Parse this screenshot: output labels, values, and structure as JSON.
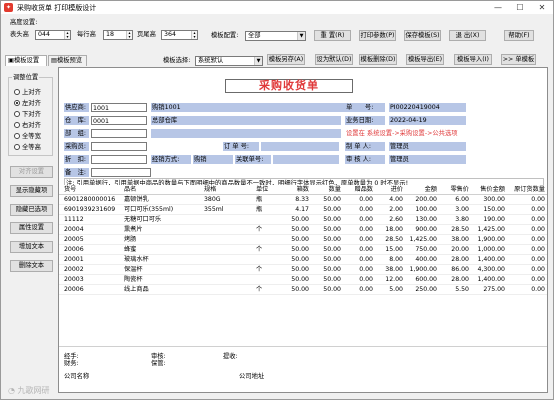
{
  "window": {
    "title": "采购收货单 打印模版设计"
  },
  "margins": {
    "group_label": "高度设置:",
    "header_label": "表头高",
    "header_value": "044",
    "row_label": "每行高",
    "row_value": "18",
    "footer_label": "页尾高",
    "footer_value": "364"
  },
  "template_setting": {
    "label": "模板配置:",
    "value": "全部"
  },
  "toolbar": {
    "reset": "重 置(R)",
    "print_params": "打印参数(P)",
    "save_template": "保存模板(S)",
    "exit": "退 出(X)",
    "help": "帮助(F)"
  },
  "tabs": {
    "template_settings": "模板设置",
    "template_preview": "模板预览"
  },
  "row2": {
    "template_select_label": "模板选择:",
    "template_select_value": "系统默认",
    "save_as": "模板另存(A)",
    "set_default": "设为默认(D)",
    "delete": "模板删除(D)",
    "export": "模板导出(E)",
    "import": "模板导入(I)",
    "single": ">> 单模板"
  },
  "align": {
    "title": "调整位置",
    "options": [
      "上对齐",
      "左对齐",
      "下对齐",
      "右对齐",
      "全等宽",
      "全等高"
    ],
    "selected": "左对齐"
  },
  "side_buttons": {
    "align_setting": "对齐设置",
    "show_hidden": "显示隐藏项",
    "hide_selected": "隐藏已选项",
    "properties": "属性设置",
    "add_text": "增加文本",
    "delete_text": "删除文本"
  },
  "bill": {
    "title": "采购收货单",
    "supplier_label": "供应商:",
    "supplier_code": "1001",
    "supplier_name": "购销1001",
    "warehouse_label": "仓　库:",
    "warehouse_code": "0001",
    "warehouse_name": "总部仓库",
    "dept_label": "部　组:",
    "buyer_label": "采购员:",
    "discount_label": "折　扣:",
    "remark_label": "备　注:",
    "docno_label": "单　　号:",
    "docno_value": "PI00220419004",
    "bizdate_label": "业务日期:",
    "bizdate_value": "2022-04-19",
    "settings_hint": "设置在 系统设置->采购设置->公共选项",
    "order_label": "订 单 号:",
    "maker_label": "制 单 人:",
    "maker_value": "管理员",
    "settle_label": "经销方式:",
    "settle_value": "购销",
    "related_label": "关联单号:",
    "auditor_label": "审 核 人:",
    "auditor_value": "管理员",
    "note_label": "注:",
    "note_text": "引用单据行，引用单据中商品的数量与下面明细中的商品数量不一致时，明细行字体显示红色，原单数量为 0 时不显示!"
  },
  "table": {
    "headers": [
      "货号",
      "品名",
      "规格",
      "单位",
      "箱数",
      "数量",
      "赠品数",
      "进价",
      "金额",
      "零售价",
      "售价金额",
      "原订货数量"
    ],
    "rows": [
      [
        "6901280000016",
        "嘉顿饼乳",
        "380G",
        "瓶",
        "8.33",
        "50.00",
        "0.00",
        "4.00",
        "200.00",
        "6.00",
        "300.00",
        "0.00"
      ],
      [
        "6901939231609",
        "可口可乐(355ml)",
        "355ml",
        "瓶",
        "4.17",
        "50.00",
        "0.00",
        "2.00",
        "100.00",
        "3.00",
        "150.00",
        "0.00"
      ],
      [
        "11112",
        "无糖可口可乐",
        "",
        "",
        "50.00",
        "50.00",
        "0.00",
        "2.60",
        "130.00",
        "3.80",
        "190.00",
        "0.00"
      ],
      [
        "20004",
        "熏煮片",
        "",
        "个",
        "50.00",
        "50.00",
        "0.00",
        "18.00",
        "900.00",
        "28.50",
        "1,425.00",
        "0.00"
      ],
      [
        "20005",
        "烤肠",
        "",
        "",
        "50.00",
        "50.00",
        "0.00",
        "28.50",
        "1,425.00",
        "38.00",
        "1,900.00",
        "0.00"
      ],
      [
        "20006",
        "蜂蜜",
        "",
        "个",
        "50.00",
        "50.00",
        "0.00",
        "15.00",
        "750.00",
        "20.00",
        "1,000.00",
        "0.00"
      ],
      [
        "20001",
        "玻璃水杯",
        "",
        "",
        "50.00",
        "50.00",
        "0.00",
        "8.00",
        "400.00",
        "28.00",
        "1,400.00",
        "0.00"
      ],
      [
        "20002",
        "保温杯",
        "",
        "个",
        "50.00",
        "50.00",
        "0.00",
        "38.00",
        "1,900.00",
        "86.00",
        "4,300.00",
        "0.00"
      ],
      [
        "20003",
        "陶瓷杯",
        "",
        "",
        "50.00",
        "50.00",
        "0.00",
        "12.00",
        "600.00",
        "28.00",
        "1,400.00",
        "0.00"
      ],
      [
        "20006",
        "线上商品",
        "",
        "个",
        "50.00",
        "50.00",
        "0.00",
        "5.00",
        "250.00",
        "5.50",
        "275.00",
        "0.00"
      ]
    ]
  },
  "footer": {
    "handler": "经手:",
    "reviewer": "审核:",
    "finance": "财务:",
    "keeper": "保管:",
    "receiver": "提收:",
    "company_name": "公司名称",
    "company_address": "公司地址"
  },
  "watermark": "九歌网研"
}
